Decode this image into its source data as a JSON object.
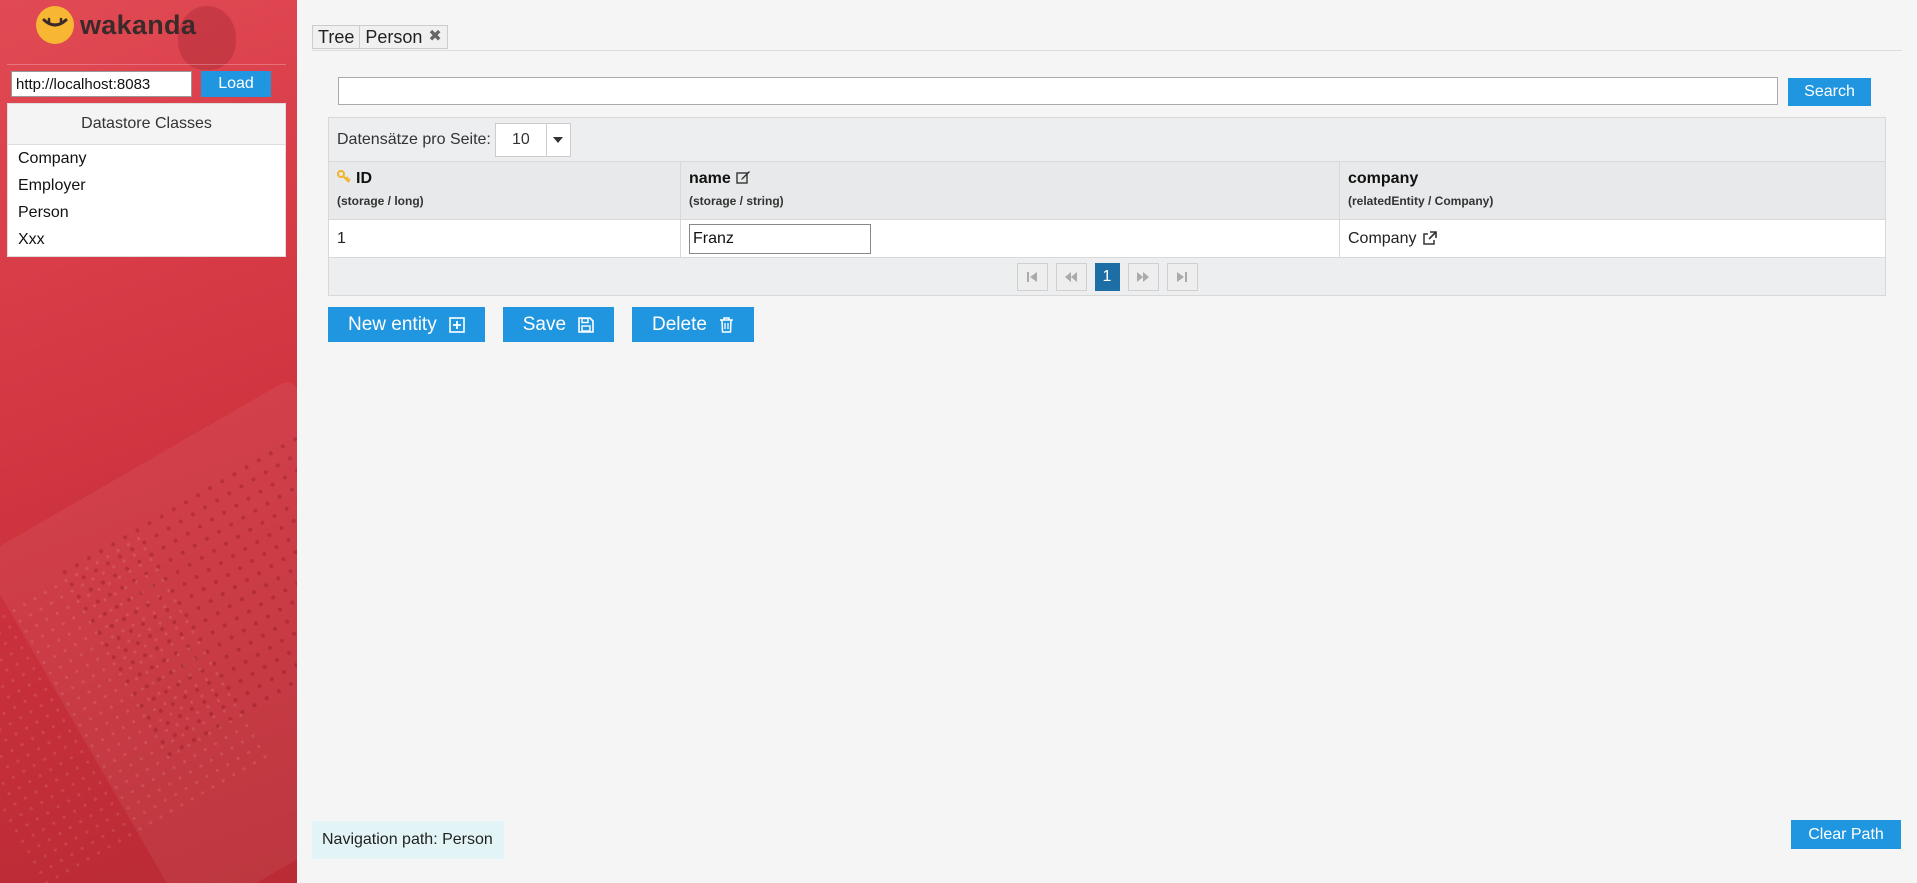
{
  "sidebar": {
    "logo_text": "wakanda",
    "url_value": "http://localhost:8083",
    "load_label": "Load",
    "ds_title": "Datastore Classes",
    "ds_items": [
      {
        "label": "Company"
      },
      {
        "label": "Employer"
      },
      {
        "label": "Person"
      },
      {
        "label": "Xxx"
      }
    ]
  },
  "tabs": [
    {
      "label": "Tree"
    },
    {
      "label": "Person",
      "close": "✖"
    }
  ],
  "search": {
    "value": "",
    "button_label": "Search"
  },
  "grid": {
    "page_size_label": "Datensätze pro Seite:",
    "page_size_value": "10",
    "columns": [
      {
        "title": "ID",
        "sub": "(storage / long)",
        "icon": "key-icon"
      },
      {
        "title": "name",
        "sub": "(storage / string)",
        "icon": "edit-icon"
      },
      {
        "title": "company",
        "sub": "(relatedEntity / Company)"
      }
    ],
    "rows": [
      {
        "id": "1",
        "name": "Franz",
        "company": "Company"
      }
    ],
    "current_page": "1"
  },
  "actions": {
    "new_label": "New entity",
    "save_label": "Save",
    "delete_label": "Delete"
  },
  "footer": {
    "nav_path": "Navigation path: Person",
    "clear_label": "Clear Path"
  },
  "colors": {
    "accent": "#2196e0",
    "sidebar": "#d63a45",
    "active_page": "#1c6ea4",
    "logo": "#f7b733"
  }
}
